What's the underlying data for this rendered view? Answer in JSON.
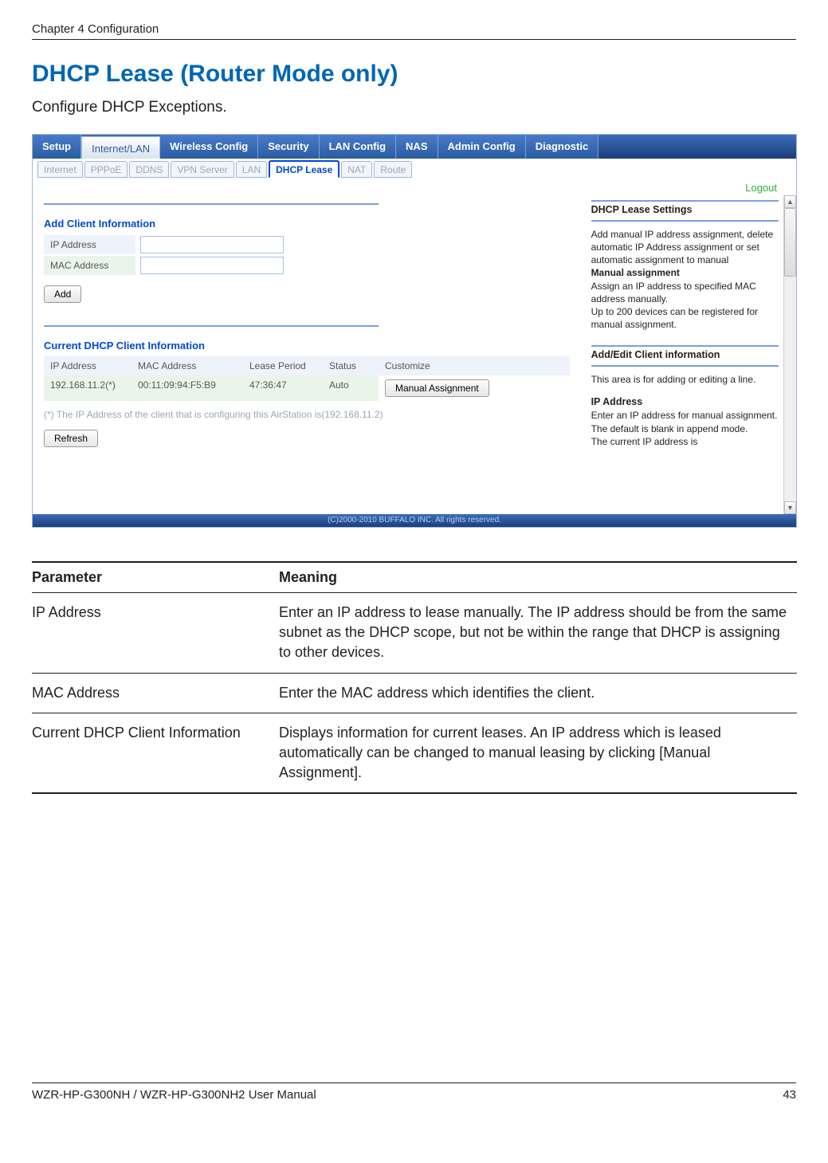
{
  "header": {
    "chapter": "Chapter 4  Configuration"
  },
  "section": {
    "title": "DHCP Lease (Router Mode only)",
    "intro": "Configure DHCP Exceptions."
  },
  "screenshot": {
    "mainTabs": [
      "Setup",
      "Internet/LAN",
      "Wireless Config",
      "Security",
      "LAN Config",
      "NAS",
      "Admin Config",
      "Diagnostic"
    ],
    "mainActiveIndex": 1,
    "subTabs": [
      "Internet",
      "PPPoE",
      "DDNS",
      "VPN Server",
      "LAN",
      "DHCP Lease",
      "NAT",
      "Route"
    ],
    "subActiveIndex": 5,
    "logout": "Logout",
    "leftPanel": {
      "addTitle": "Add Client Information",
      "ipLabel": "IP Address",
      "macLabel": "MAC Address",
      "addBtn": "Add",
      "currentTitle": "Current DHCP Client Information",
      "cols": [
        "IP Address",
        "MAC Address",
        "Lease Period",
        "Status",
        "Customize"
      ],
      "row": [
        "192.168.11.2(*)",
        "00:11:09:94:F5:B9",
        "47:36:47",
        "Auto"
      ],
      "manualBtn": "Manual Assignment",
      "note": "(*) The IP Address of the client that is configuring this AirStation is(192.168.11.2)",
      "refreshBtn": "Refresh"
    },
    "rightPanel": {
      "h1": "DHCP Lease Settings",
      "p1": "Add manual IP address assignment, delete automatic IP Address assignment or set automatic assignment to manual",
      "b1": "Manual assignment",
      "p2": "Assign an IP address to specified MAC address manually.",
      "p3": "Up to 200 devices can be registered for manual assignment.",
      "h2": "Add/Edit Client information",
      "p4": "This area is for adding or editing a line.",
      "h3": "IP Address",
      "p5": "Enter an IP address for manual assignment.",
      "p6": "The default is blank in append mode.",
      "p7": "The current IP address is"
    },
    "footer": "(C)2000-2010 BUFFALO INC. All rights reserved."
  },
  "paramTable": {
    "headParam": "Parameter",
    "headMeaning": "Meaning",
    "rows": [
      {
        "p": "IP Address",
        "m": "Enter an IP address to lease manually. The IP address should be from the same subnet as the DHCP scope, but not be within the range that DHCP is assigning to other devices."
      },
      {
        "p": "MAC Address",
        "m": "Enter the MAC address which identifies the client."
      },
      {
        "p": "Current DHCP Client Information",
        "m": "Displays information for current leases. An IP address which is leased automatically can be changed to manual leasing by clicking [Manual Assignment]."
      }
    ]
  },
  "footer": {
    "manual": "WZR-HP-G300NH / WZR-HP-G300NH2 User Manual",
    "page": "43"
  }
}
